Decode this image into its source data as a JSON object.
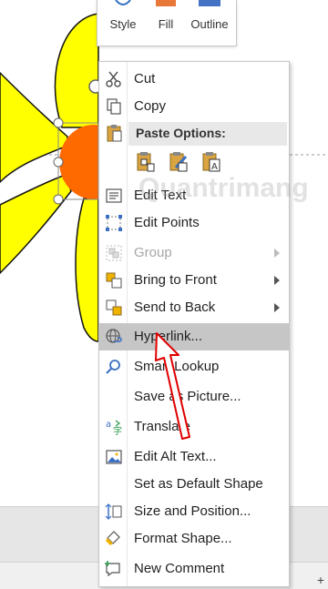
{
  "ribbon": {
    "style_label": "Style",
    "fill_label": "Fill",
    "outline_label": "Outline"
  },
  "menu": {
    "cut": "Cut",
    "copy": "Copy",
    "paste_options": "Paste Options:",
    "edit_text": "Edit Text",
    "edit_points": "Edit Points",
    "group": "Group",
    "bring_to_front": "Bring to Front",
    "send_to_back": "Send to Back",
    "hyperlink": "Hyperlink...",
    "smart_lookup": "Smart Lookup",
    "save_as_picture": "Save as Picture...",
    "translate": "Translate",
    "edit_alt_text": "Edit Alt Text...",
    "set_default_shape": "Set as Default Shape",
    "size_and_position": "Size and Position...",
    "format_shape": "Format Shape...",
    "new_comment": "New Comment"
  },
  "watermark": "Quantrimang",
  "status": {
    "zoom_plus": "+"
  },
  "colors": {
    "petal": "#ffff00",
    "center": "#ff6a00",
    "highlight": "#c6c6c6",
    "annotation": "#e00000",
    "fill_bar": "#e8773a",
    "outline_bar": "#4472c4"
  }
}
